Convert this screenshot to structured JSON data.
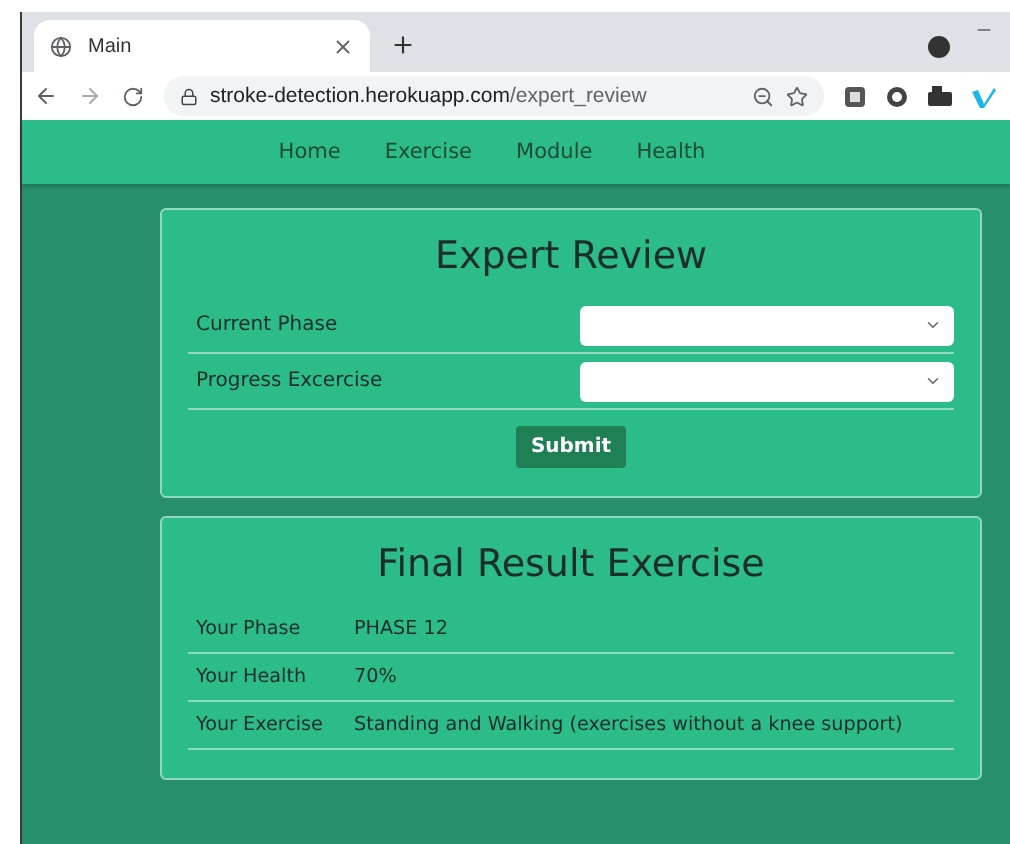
{
  "browser": {
    "tab": {
      "title": "Main"
    },
    "url": {
      "host": "stroke-detection.herokuapp.com",
      "path": "/expert_review"
    }
  },
  "nav": [
    {
      "label": "Home"
    },
    {
      "label": "Exercise"
    },
    {
      "label": "Module"
    },
    {
      "label": "Health"
    }
  ],
  "expert_review": {
    "title": "Expert Review",
    "fields": [
      {
        "label": "Current Phase"
      },
      {
        "label": "Progress Excercise"
      }
    ],
    "submit": "Submit"
  },
  "final_result": {
    "title": "Final Result Exercise",
    "rows": [
      {
        "label": "Your Phase",
        "value": "PHASE 12"
      },
      {
        "label": "Your Health",
        "value": "70%"
      },
      {
        "label": "Your Exercise",
        "value": "Standing and Walking (exercises without a knee support)"
      }
    ]
  }
}
